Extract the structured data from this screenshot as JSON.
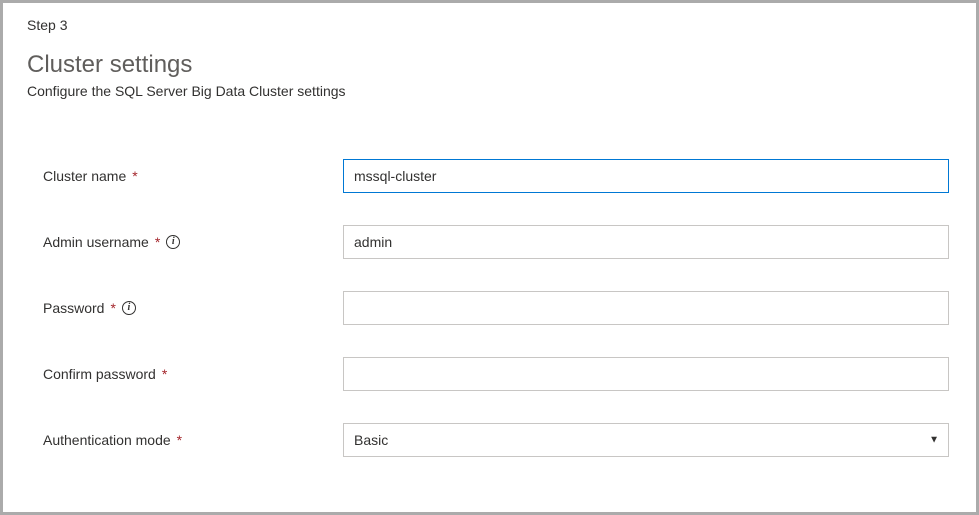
{
  "step_label": "Step 3",
  "page_title": "Cluster settings",
  "page_subtitle": "Configure the SQL Server Big Data Cluster settings",
  "required_mark": "*",
  "fields": {
    "cluster_name": {
      "label": "Cluster name",
      "value": "mssql-cluster"
    },
    "admin_username": {
      "label": "Admin username",
      "value": "admin"
    },
    "password": {
      "label": "Password",
      "value": ""
    },
    "confirm_password": {
      "label": "Confirm password",
      "value": ""
    },
    "auth_mode": {
      "label": "Authentication mode",
      "value": "Basic"
    }
  }
}
